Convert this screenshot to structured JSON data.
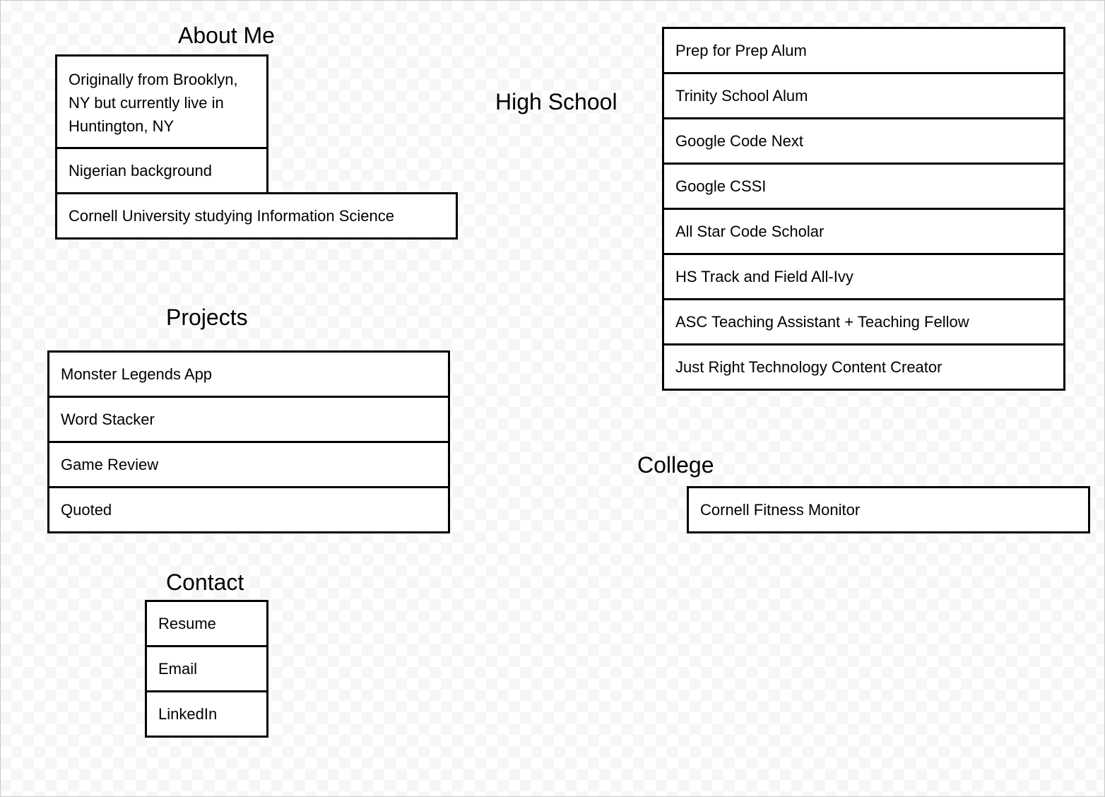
{
  "about_me": {
    "title": "About Me",
    "items": [
      "Originally from Brooklyn, NY but currently live in Huntington, NY",
      "Nigerian background",
      "Cornell University studying Information Science"
    ]
  },
  "projects": {
    "title": "Projects",
    "items": [
      "Monster Legends App",
      "Word Stacker",
      "Game Review",
      "Quoted"
    ]
  },
  "contact": {
    "title": "Contact",
    "items": [
      "Resume",
      "Email",
      "LinkedIn"
    ]
  },
  "high_school": {
    "title": "High School",
    "items": [
      "Prep for Prep Alum",
      "Trinity School Alum",
      "Google Code Next",
      "Google CSSI",
      "All Star Code Scholar",
      "HS Track and Field All-Ivy",
      "ASC Teaching Assistant + Teaching Fellow",
      "Just Right Technology Content Creator"
    ]
  },
  "college": {
    "title": "College",
    "items": [
      "Cornell Fitness Monitor"
    ]
  }
}
